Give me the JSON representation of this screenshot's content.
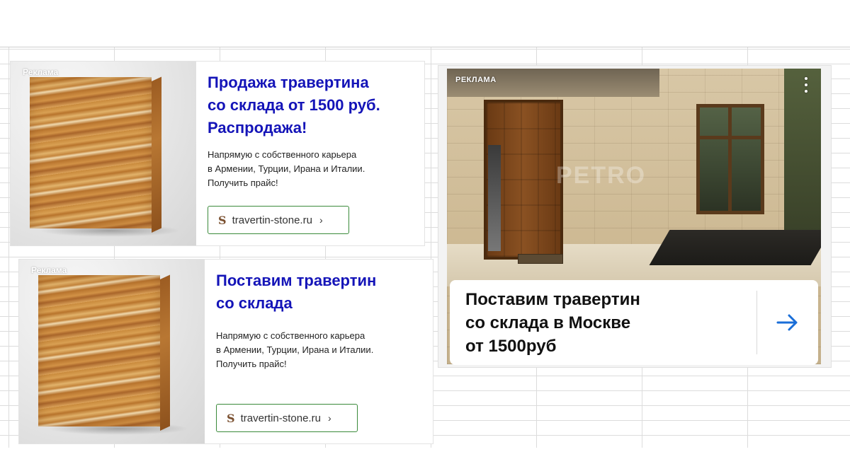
{
  "ads": [
    {
      "label": "Реклама",
      "title_lines": [
        "Продажа травертина",
        "со склада от 1500 руб.",
        "Распродажа!"
      ],
      "desc_lines": [
        "Напрямую с собственного карьера",
        "в Армении, Турции, Ирана и Италии.",
        "Получить прайс!"
      ],
      "link_icon": "S",
      "link_text": "travertin-stone.ru",
      "link_chevron": "›"
    },
    {
      "label": "Реклама",
      "title_lines": [
        "Поставим травертин",
        "со склада"
      ],
      "desc_lines": [
        "Напрямую с собственного карьера",
        "в Армении, Турции, Ирана и Италии.",
        "Получить прайс!"
      ],
      "link_icon": "S",
      "link_text": "travertin-stone.ru",
      "link_chevron": "›"
    }
  ],
  "big_ad": {
    "label": "РЕКЛАМА",
    "watermark": "PETRO",
    "title_lines": [
      "Поставим травертин",
      "со склада в Москве",
      "от 1500руб"
    ],
    "arrow_icon": "arrow-right-icon",
    "arrow_color": "#1a6ed8"
  },
  "colors": {
    "ad_title": "#1414b8",
    "link_border": "#3a8a3a"
  }
}
